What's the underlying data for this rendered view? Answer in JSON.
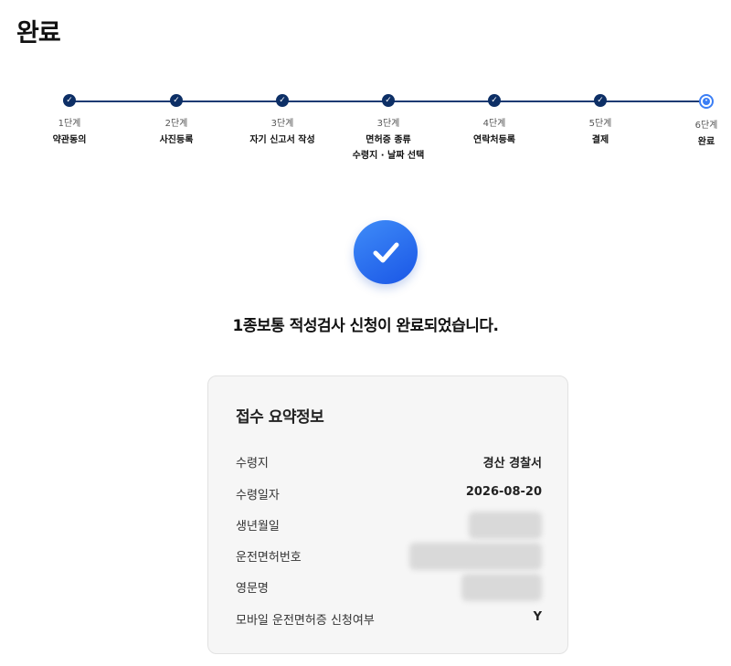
{
  "page": {
    "title": "완료"
  },
  "stepper": {
    "steps": [
      {
        "no": "1단계",
        "label": "약관동의",
        "state": "done"
      },
      {
        "no": "2단계",
        "label": "사진등록",
        "state": "done"
      },
      {
        "no": "3단계",
        "label": "자기 신고서 작성",
        "state": "done"
      },
      {
        "no": "3단계",
        "label": "면허증 종류",
        "label2": "수령지 · 날짜 선택",
        "state": "done"
      },
      {
        "no": "4단계",
        "label": "연락처등록",
        "state": "done"
      },
      {
        "no": "5단계",
        "label": "결제",
        "state": "done"
      },
      {
        "no": "6단계",
        "label": "완료",
        "state": "current"
      }
    ]
  },
  "completion": {
    "message": "1종보통 적성검사 신청이 완료되었습니다.",
    "icon": "check-icon",
    "icon_color": "#2a6cf0"
  },
  "summary": {
    "title": "접수 요약정보",
    "rows": [
      {
        "label": "수령지",
        "value": "경산 경찰서"
      },
      {
        "label": "수령일자",
        "value": "2026-08-20"
      },
      {
        "label": "생년월일",
        "value": ""
      },
      {
        "label": "운전면허번호",
        "value": ""
      },
      {
        "label": "영문명",
        "value": ""
      },
      {
        "label": "모바일 운전면허증 신청여부",
        "value": "Y"
      }
    ]
  },
  "colors": {
    "step_done": "#0d2f66",
    "step_current": "#3b7ef5",
    "accent": "#2a6cf0"
  }
}
